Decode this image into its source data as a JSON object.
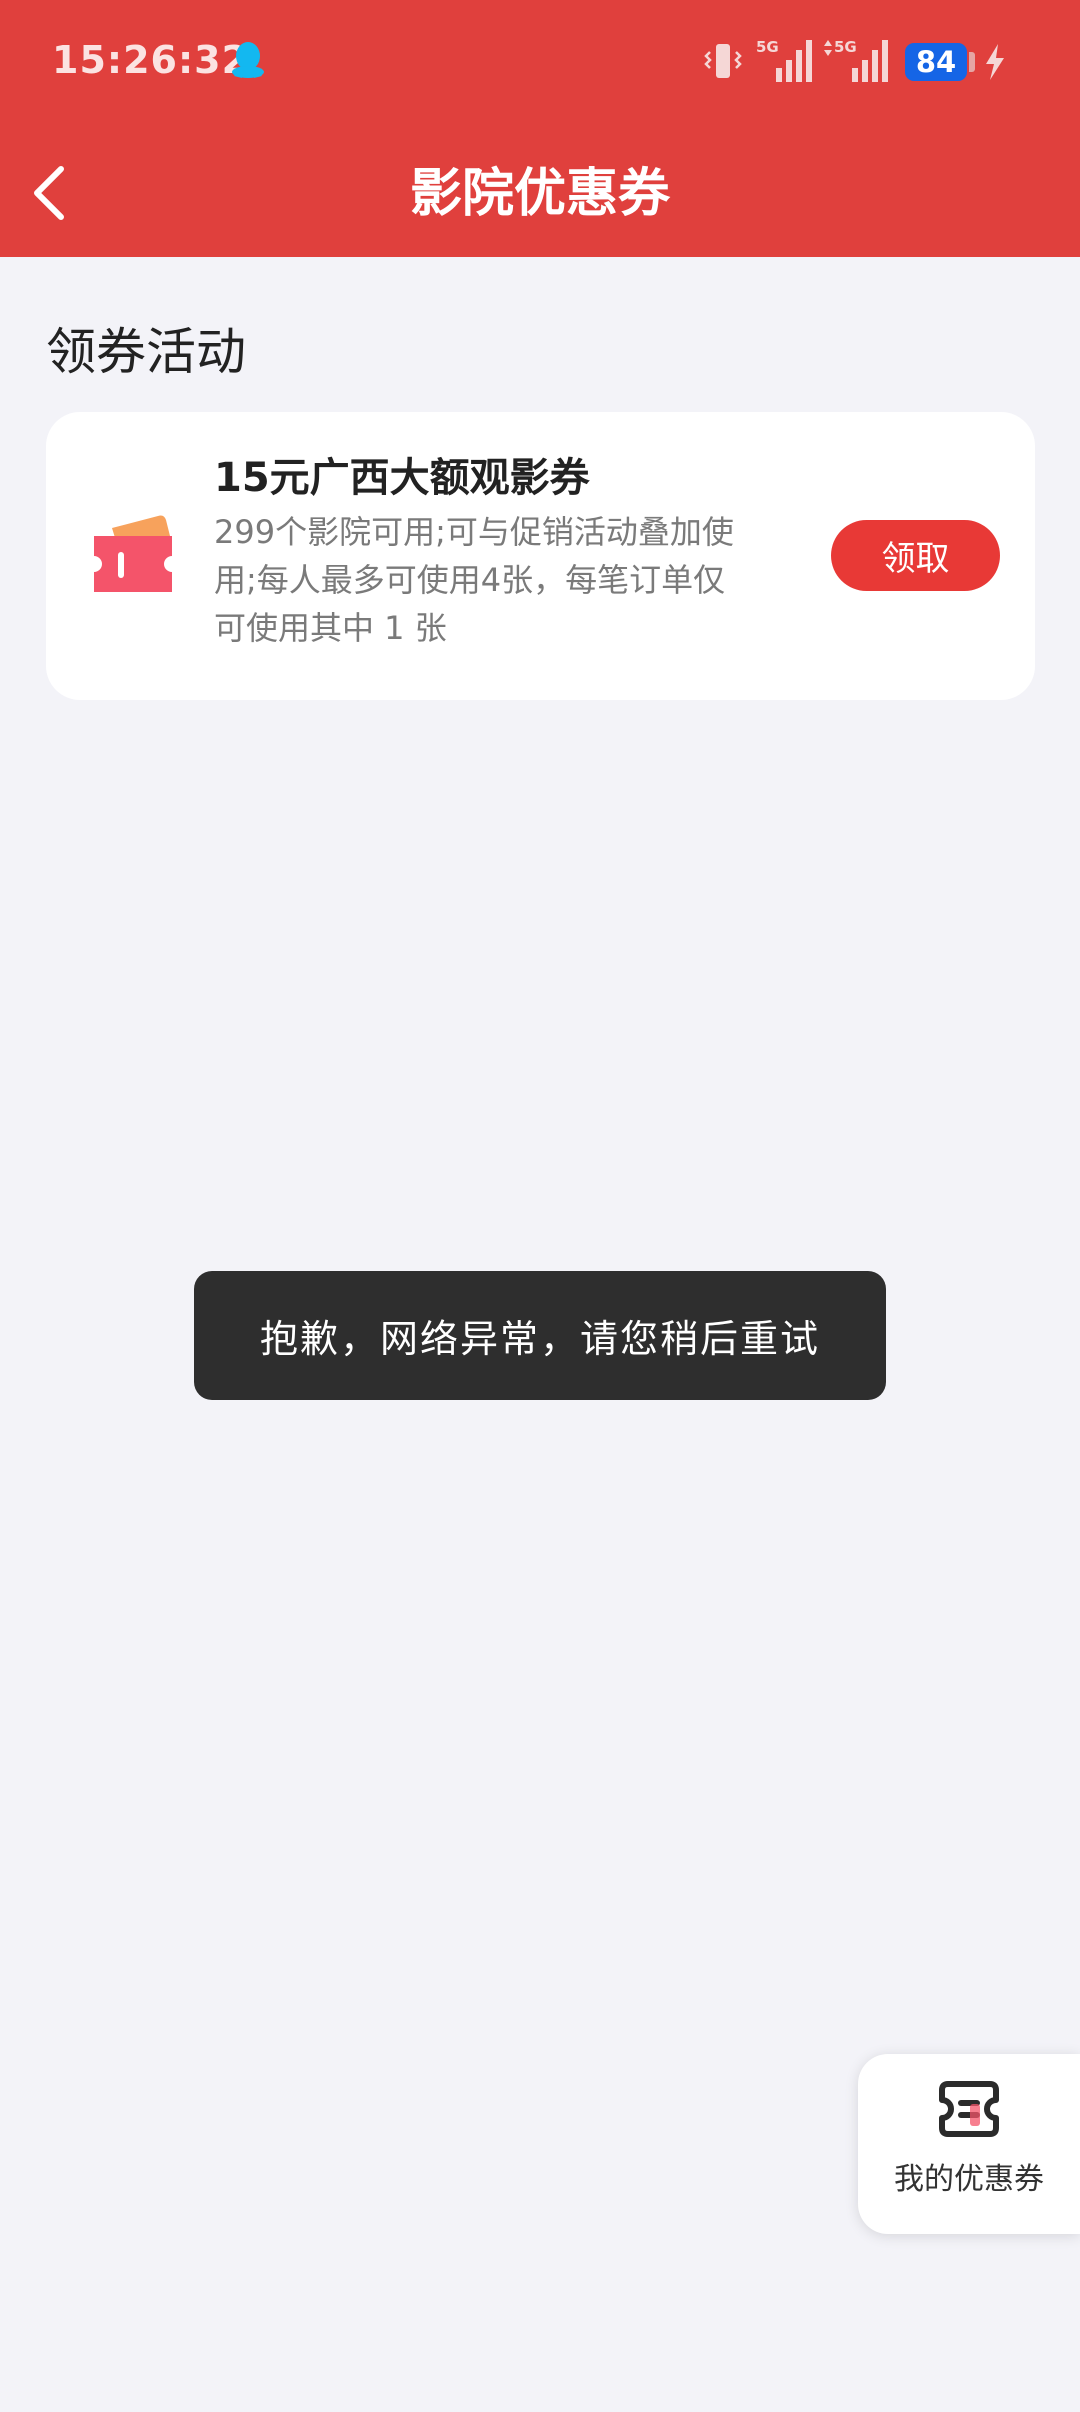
{
  "status_bar": {
    "time": "15:26:32",
    "battery": "84",
    "network_1": "5G",
    "network_2": "5G"
  },
  "nav": {
    "title": "影院优惠券"
  },
  "section": {
    "title": "领券活动"
  },
  "coupon": {
    "name": "15元广西大额观影券",
    "description": "299个影院可用;可与促销活动叠加使用;每人最多可使用4张，每笔订单仅可使用其中 1 张",
    "button_label": "领取"
  },
  "toast": {
    "message": "抱歉，网络异常，请您稍后重试"
  },
  "floating": {
    "my_coupons_label": "我的优惠券"
  },
  "colors": {
    "header": "#e0403d",
    "accent": "#e83936",
    "background": "#f3f3f8",
    "battery": "#1565e6"
  }
}
